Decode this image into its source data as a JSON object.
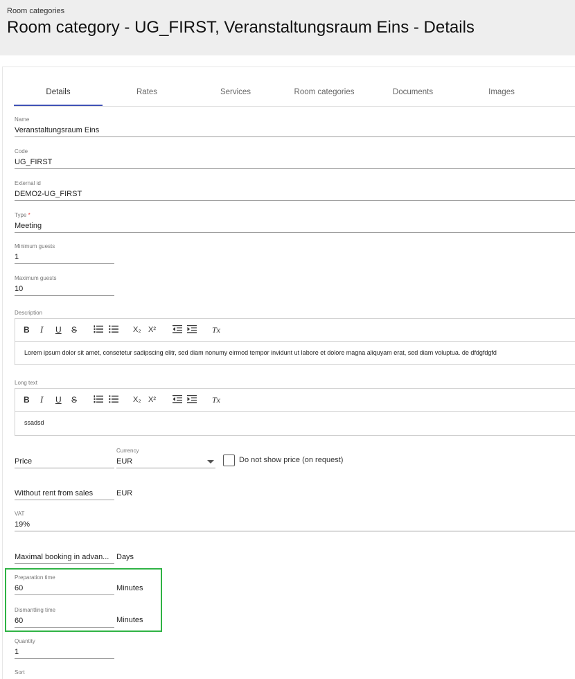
{
  "header": {
    "breadcrumb": "Room categories",
    "title": "Room category - UG_FIRST, Veranstaltungsraum Eins - Details"
  },
  "tabs": [
    {
      "label": "Details",
      "active": true
    },
    {
      "label": "Rates",
      "active": false
    },
    {
      "label": "Services",
      "active": false
    },
    {
      "label": "Room categories",
      "active": false
    },
    {
      "label": "Documents",
      "active": false
    },
    {
      "label": "Images",
      "active": false
    }
  ],
  "form": {
    "name": {
      "label": "Name",
      "value": "Veranstaltungsraum Eins"
    },
    "code": {
      "label": "Code",
      "value": "UG_FIRST"
    },
    "external_id": {
      "label": "External id",
      "value": "DEMO2-UG_FIRST"
    },
    "type": {
      "label": "Type",
      "required_mark": "*",
      "value": "Meeting"
    },
    "min_guests": {
      "label": "Minimum guests",
      "value": "1"
    },
    "max_guests": {
      "label": "Maximum guests",
      "value": "10"
    },
    "description": {
      "label": "Description",
      "content": "Lorem ipsum dolor sit amet, consetetur sadipscing elitr, sed diam nonumy eirmod tempor invidunt ut labore et dolore magna aliquyam erat, sed diam voluptua. de dfdgfdgfd"
    },
    "long_text": {
      "label": "Long text",
      "content": "ssadsd"
    },
    "toolbar": {
      "bold": "B",
      "italic": "I",
      "underline": "U",
      "strike": "S",
      "subscript": "X₂",
      "superscript": "X²",
      "clear": "Tx"
    },
    "price": {
      "placeholder": "Price"
    },
    "currency": {
      "label": "Currency",
      "value": "EUR"
    },
    "no_price_checkbox": {
      "label": "Do not show price (on request)",
      "checked": false
    },
    "without_rent": {
      "placeholder": "Without rent from sales",
      "unit": "EUR"
    },
    "vat": {
      "label": "VAT",
      "value": "19%"
    },
    "max_booking": {
      "placeholder": "Maximal booking in advan...",
      "unit": "Days"
    },
    "preparation_time": {
      "label": "Preparation time",
      "value": "60",
      "unit": "Minutes"
    },
    "dismantling_time": {
      "label": "Dismantling time",
      "value": "60",
      "unit": "Minutes"
    },
    "quantity": {
      "label": "Quantity",
      "value": "1"
    },
    "sort": {
      "label": "Sort"
    }
  },
  "colors": {
    "accent": "#3f51b5",
    "highlight": "#2fb344",
    "required": "#e53935"
  }
}
